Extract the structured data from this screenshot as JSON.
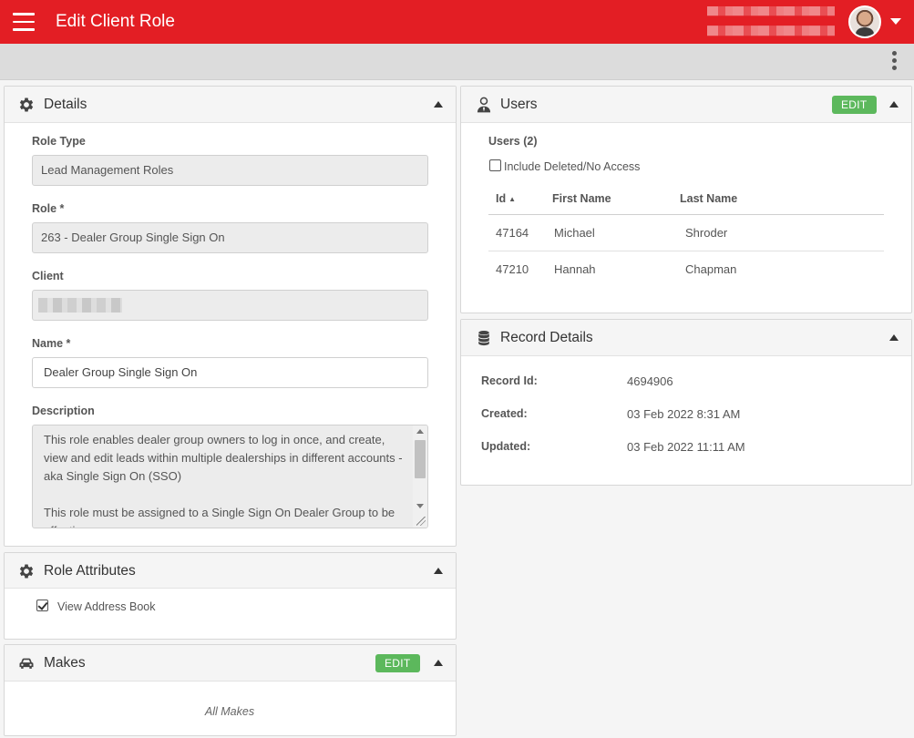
{
  "header": {
    "title": "Edit Client Role"
  },
  "details": {
    "title": "Details",
    "role_type_label": "Role Type",
    "role_type_value": "Lead Management Roles",
    "role_label": "Role *",
    "role_value": "263 - Dealer Group Single Sign On",
    "client_label": "Client",
    "name_label": "Name *",
    "name_value": "Dealer Group Single Sign On",
    "description_label": "Description",
    "description_value": "This role enables dealer group owners to log in once, and create, view and edit leads within multiple dealerships in different accounts - aka Single Sign On (SSO)\n\nThis role must be assigned to a Single Sign On Dealer Group to be effective"
  },
  "role_attributes": {
    "title": "Role Attributes",
    "items": [
      {
        "label": "View Address Book",
        "checked": true
      }
    ]
  },
  "makes": {
    "title": "Makes",
    "edit_label": "EDIT",
    "empty_text": "All Makes"
  },
  "users": {
    "title": "Users",
    "edit_label": "EDIT",
    "count_label": "Users (2)",
    "include_deleted_label": "Include Deleted/No Access",
    "include_deleted_checked": false,
    "columns": [
      "Id",
      "First Name",
      "Last Name"
    ],
    "sort_indicator": "▲",
    "rows": [
      {
        "id": "47164",
        "first": "Michael",
        "last": "Shroder"
      },
      {
        "id": "47210",
        "first": "Hannah",
        "last": "Chapman"
      }
    ]
  },
  "record_details": {
    "title": "Record Details",
    "record_id_label": "Record Id:",
    "record_id_value": "4694906",
    "created_label": "Created:",
    "created_value": "03 Feb 2022 8:31 AM",
    "updated_label": "Updated:",
    "updated_value": "03 Feb 2022 11:11 AM"
  },
  "colors": {
    "brand": "#e31e24",
    "edit_button": "#5cb85c"
  },
  "icons": {
    "menu": "hamburger-icon",
    "more": "kebab-icon",
    "details": "gear-icon",
    "attributes": "gear-icon",
    "makes": "car-icon",
    "users": "user-icon",
    "record": "database-icon"
  }
}
